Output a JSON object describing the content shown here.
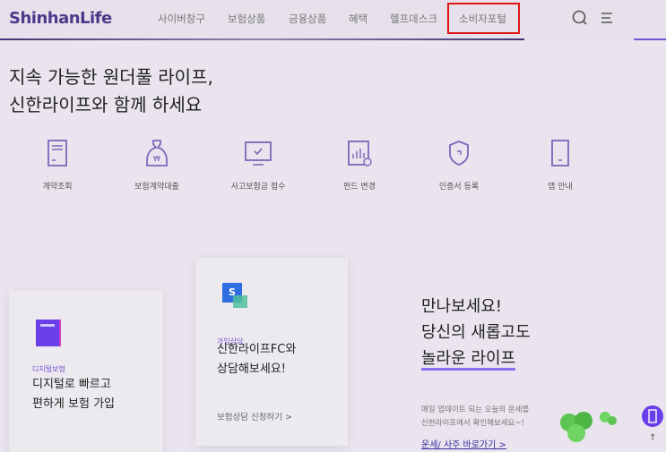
{
  "header": {
    "logo": "ShinhanLife",
    "nav": [
      "사이버창구",
      "보험상품",
      "금융상품",
      "혜택",
      "헬프데스크",
      "소비자포털"
    ]
  },
  "hero": {
    "line1": "지속 가능한 원더풀 라이프,",
    "line2": "신한라이프와 함께 하세요"
  },
  "quick_menu": [
    "계약조회",
    "보험계약대출",
    "사고보험금 접수",
    "펀드 변경",
    "인증서 등록",
    "앱 안내"
  ],
  "cards": [
    {
      "tag": "디지털보험",
      "title1": "디지털로 빠르고",
      "title2": "편하게 보험 가입"
    },
    {
      "tag": "가입상담",
      "title1": "신한라이프FC와",
      "title2": "상담해보세요!",
      "link": "보험상담 신청하기 >"
    }
  ],
  "promo": {
    "line1": "만나보세요!",
    "line2": "당신의 새롭고도",
    "line3": "놀라운 라이프",
    "desc1": "매일 업데이트 되는 오늘의 운세를",
    "desc2": "신한라이프에서 확인해보세요~!",
    "link": "운세/ 사주 바로가기 >"
  },
  "colors": {
    "brand": "#4b3a8c",
    "accent": "#6a4fd0",
    "highlight": "#e01515"
  }
}
